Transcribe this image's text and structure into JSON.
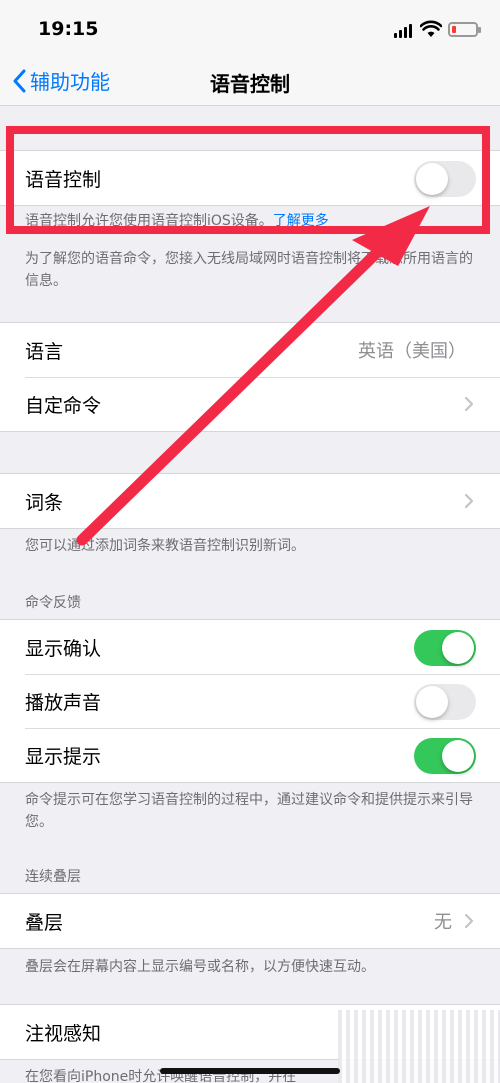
{
  "status_bar": {
    "time": "19:15"
  },
  "nav": {
    "back_label": "辅助功能",
    "title": "语音控制"
  },
  "voice_control": {
    "label": "语音控制",
    "enabled": false,
    "note_text": "语音控制允许您使用语音控制iOS设备。",
    "note_link": "了解更多",
    "download_note": "为了解您的语音命令，您接入无线局域网时语音控制将下载您所用语言的信息。"
  },
  "language_group": {
    "language_label": "语言",
    "language_value": "英语（美国）",
    "custom_commands_label": "自定命令"
  },
  "vocabulary_group": {
    "label": "词条",
    "note": "您可以通过添加词条来教语音控制识别新词。"
  },
  "command_feedback": {
    "header": "命令反馈",
    "items": [
      {
        "label": "显示确认",
        "enabled": true
      },
      {
        "label": "播放声音",
        "enabled": false
      },
      {
        "label": "显示提示",
        "enabled": true
      }
    ],
    "note": "命令提示可在您学习语音控制的过程中，通过建议命令和提供提示来引导您。"
  },
  "continuous_overlay": {
    "header": "连续叠层",
    "overlay_label": "叠层",
    "overlay_value": "无",
    "note": "叠层会在屏幕内容上显示编号或名称，以方便快速互动。"
  },
  "attention": {
    "label": "注视感知",
    "note": "在您看向iPhone时允许唤醒语音控制，并在"
  },
  "colors": {
    "annotation": "#f32a46",
    "accent": "#007aff",
    "toggle_on": "#34c759"
  }
}
